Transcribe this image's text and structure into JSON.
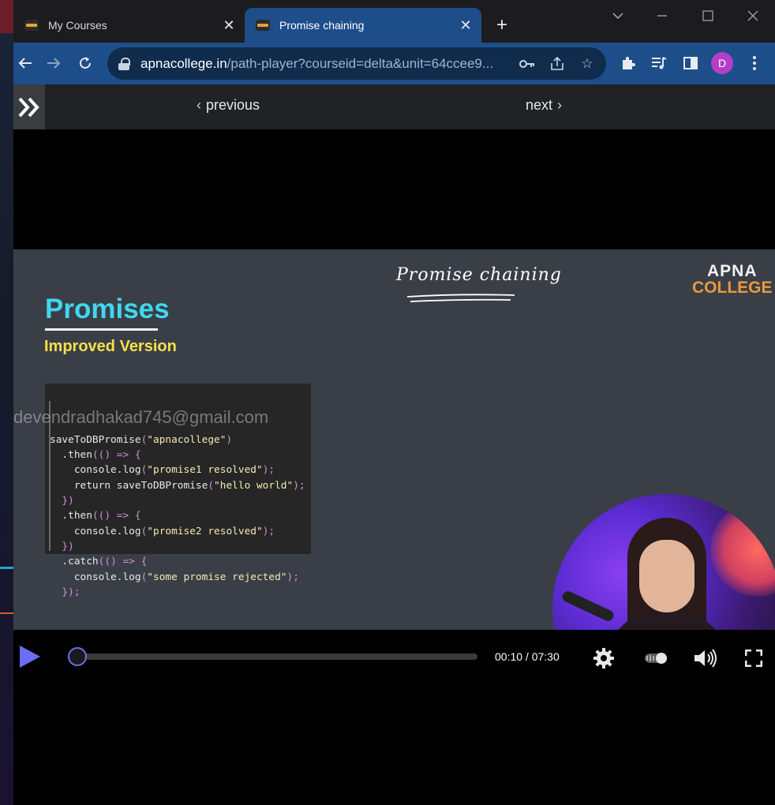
{
  "tabs": [
    {
      "title": "My Courses"
    },
    {
      "title": "Promise chaining"
    }
  ],
  "toolbar": {
    "url_host": "apnacollege.in",
    "url_path": "/path-player?courseid=delta&unit=64ccee9...",
    "profile_initial": "D"
  },
  "player_nav": {
    "previous_label": "previous",
    "next_label": "next"
  },
  "slide": {
    "title": "Promises",
    "subtitle": "Improved Version",
    "handwritten_note": "Promise chaining",
    "logo_line1": "APNA",
    "logo_line2": "COLLEGE",
    "watermark": "devendradhakad745@gmail.com",
    "code_lines": [
      "saveToDBPromise(\"apnacollege\")",
      "  .then(() => {",
      "    console.log(\"promise1 resolved\");",
      "    return saveToDBPromise(\"hello world\");",
      "  })",
      "  .then(() => {",
      "    console.log(\"promise2 resolved\");",
      "  })",
      "  .catch(() => {",
      "    console.log(\"some promise rejected\");",
      "  });"
    ]
  },
  "controls": {
    "current_time": "00:10",
    "total_time": "07:30",
    "time_display": "00:10 / 07:30",
    "progress_fraction": 0.022
  },
  "colors": {
    "accent": "#6b6ef0",
    "active_tab": "#1d4e8a",
    "slide_title": "#3fd8ee",
    "slide_subtitle": "#f4e04a"
  }
}
